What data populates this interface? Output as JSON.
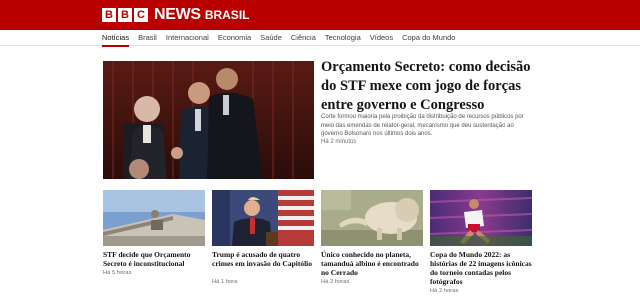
{
  "header": {
    "logo_letters": [
      "B",
      "B",
      "C"
    ],
    "logo_news": "NEWS",
    "logo_edition": "BRASIL",
    "brand_color": "#b80000"
  },
  "nav": {
    "items": [
      {
        "label": "Notícias",
        "active": true
      },
      {
        "label": "Brasil",
        "active": false
      },
      {
        "label": "Internacional",
        "active": false
      },
      {
        "label": "Economia",
        "active": false
      },
      {
        "label": "Saúde",
        "active": false
      },
      {
        "label": "Ciência",
        "active": false
      },
      {
        "label": "Tecnologia",
        "active": false
      },
      {
        "label": "Vídeos",
        "active": false
      },
      {
        "label": "Copa do Mundo",
        "active": false
      }
    ]
  },
  "lead": {
    "title": "Orçamento Secreto: como decisão do STF mexe com jogo de forças entre governo e Congresso",
    "summary": "Corte formou maioria pela proibição da distribuição de recursos públicos por meio das emendas de relator-geral, mecanismo que deu sustentação ao governo Bolsonaro nos últimos dois anos.",
    "time": "Há 2 minutos"
  },
  "cards": [
    {
      "title": "STF decide que Orçamento Secreto é inconstitucional",
      "time": "Há 5 horas"
    },
    {
      "title": "Trump é acusado de quatro crimes em invasão do Capitólio",
      "time": "Há 1 hora"
    },
    {
      "title": "Único conhecido no planeta, tamanduá albino é encontrado no Cerrado",
      "time": "Há 2 horas"
    },
    {
      "title": "Copa do Mundo 2022: as histórias de 22 imagens icônicas do torneio contadas pelos fotógrafos",
      "time": "Há 2 horas"
    }
  ]
}
